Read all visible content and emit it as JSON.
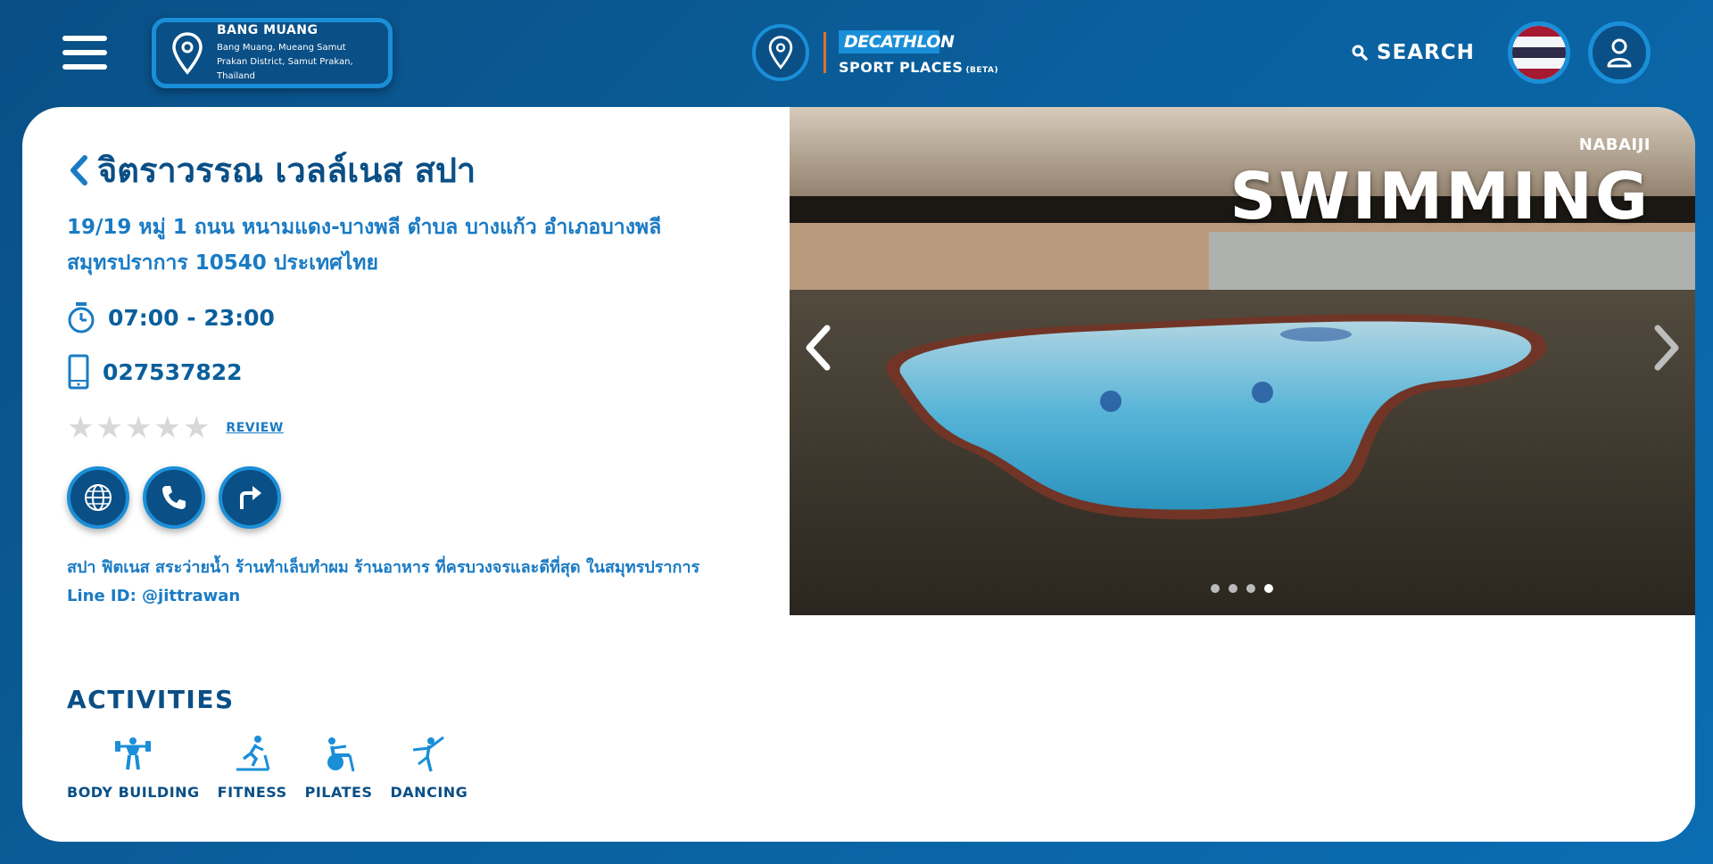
{
  "header": {
    "location": {
      "title": "BANG MUANG",
      "subtitle": "Bang Muang, Mueang Samut Prakan District, Samut Prakan, Thailand"
    },
    "brand": {
      "logo": "DECATHLON",
      "name": "SPORT PLACES",
      "badge": "(BETA)"
    },
    "search_label": "SEARCH",
    "flag_colors": [
      "#a51931",
      "#f4f5f8",
      "#2d2a4a",
      "#f4f5f8",
      "#a51931"
    ]
  },
  "place": {
    "name": "จิตราวรรณ เวลล์เนส สปา",
    "address_line1": "19/19 หมู่ 1 ถนน หนามแดง-บางพลี ตำบล บางแก้ว อำเภอบางพลี",
    "address_line2": "สมุทรปราการ 10540 ประเทศไทย",
    "hours": "07:00 - 23:00",
    "phone": "027537822",
    "rating": 0,
    "review_label": "REVIEW",
    "description_line1": "สปา ฟิตเนส สระว่ายน้ำ ร้านทำเล็บทำผม ร้านอาหาร ที่ครบวงจรและดีที่สุด ในสมุทรปราการ",
    "description_line2": "Line ID: @jittrawan"
  },
  "photo": {
    "label_top": "NABAIJI",
    "label_big": "SWIMMING",
    "slides": 4,
    "active_slide": 4
  },
  "activities": {
    "title": "ACTIVITIES",
    "items": [
      {
        "label": "BODY BUILDING",
        "icon": "bodybuilding-icon"
      },
      {
        "label": "FITNESS",
        "icon": "fitness-icon"
      },
      {
        "label": "PILATES",
        "icon": "pilates-icon"
      },
      {
        "label": "DANCING",
        "icon": "dancing-icon"
      }
    ]
  },
  "colors": {
    "primary": "#0a4f86",
    "accent": "#1a8fd8",
    "text_blue": "#1a7bc4"
  }
}
